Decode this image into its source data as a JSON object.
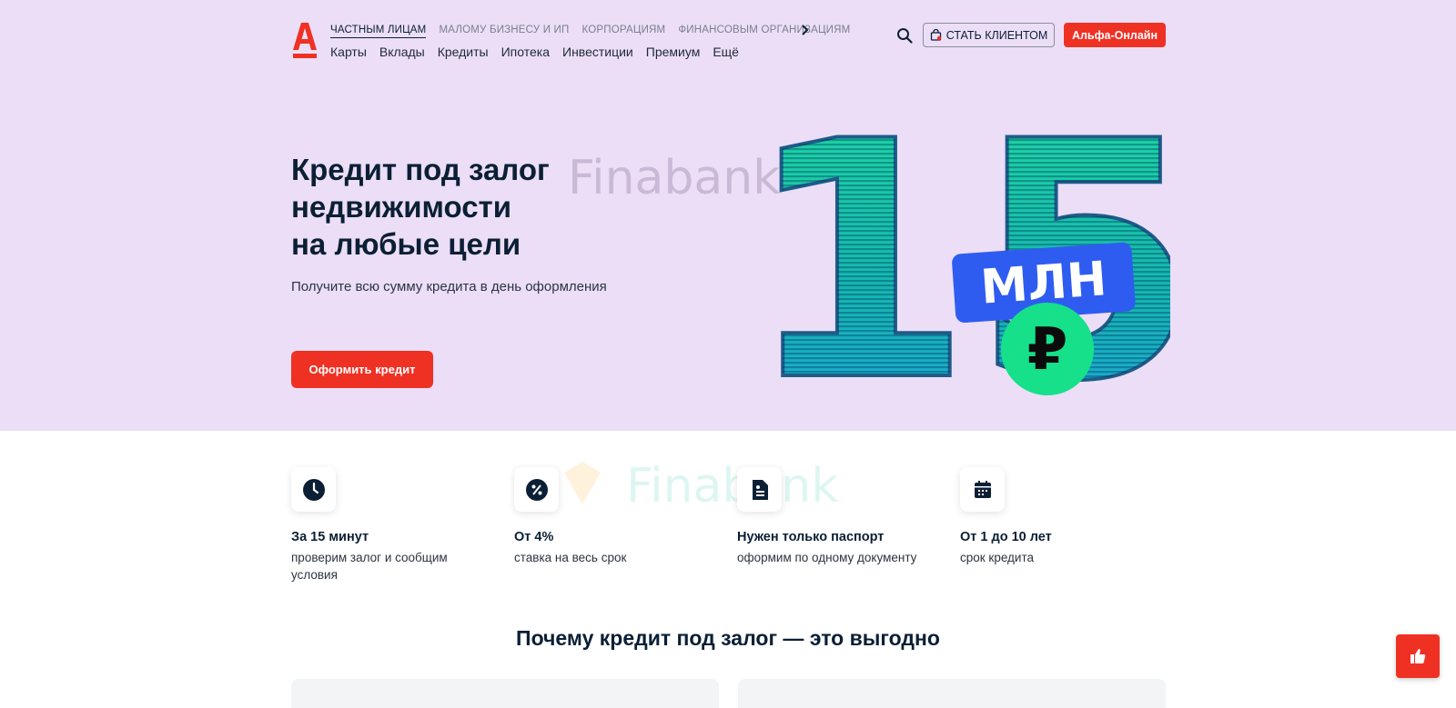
{
  "header": {
    "segments": [
      "ЧАСТНЫМ ЛИЦАМ",
      "МАЛОМУ БИЗНЕСУ И ИП",
      "КОРПОРАЦИЯМ",
      "ФИНАНСОВЫМ ОРГАНИЗАЦИЯМ"
    ],
    "active_segment": "ЧАСТНЫМ ЛИЦАМ",
    "nav": [
      "Карты",
      "Вклады",
      "Кредиты",
      "Ипотека",
      "Инвестиции",
      "Премиум",
      "Ещё"
    ],
    "become_client_label": "СТАТЬ КЛИЕНТОМ",
    "online_label": "Альфа-Онлайн"
  },
  "hero": {
    "title_lines": [
      "Кредит под залог",
      "недвижимости",
      "на любые цели"
    ],
    "subtitle": "Получите всю сумму кредита в день оформления",
    "cta_label": "Оформить кредит",
    "art_number": "15",
    "art_badge": "МЛН",
    "art_currency": "₽"
  },
  "watermark": "Finabank",
  "features": [
    {
      "icon": "clock-icon",
      "title": "За 15 минут",
      "desc": "проверим залог и сообщим условия"
    },
    {
      "icon": "percent-icon",
      "title": "От 4%",
      "desc": "ставка на весь срок"
    },
    {
      "icon": "document-icon",
      "title": "Нужен только паспорт",
      "desc": "оформим по одному документу"
    },
    {
      "icon": "calendar-icon",
      "title": "От 1 до 10 лет",
      "desc": "срок кредита"
    }
  ],
  "section_title": "Почему кредит под залог — это выгодно",
  "colors": {
    "accent": "#ef3124",
    "hero_bg": "#ecdef7",
    "text": "#0b1f35",
    "art_green": "#17c99a",
    "art_blue": "#2f5cf0",
    "art_circle": "#16e08a"
  }
}
